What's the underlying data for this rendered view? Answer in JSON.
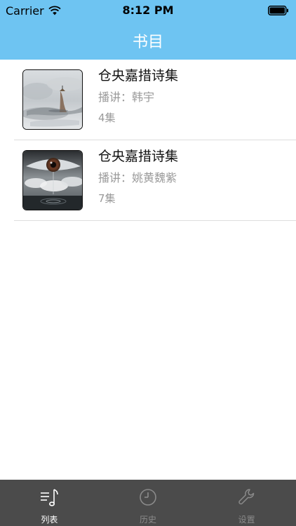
{
  "status_bar": {
    "carrier": "Carrier",
    "time": "8:12 PM",
    "wifi_icon": "wifi-icon",
    "battery_icon": "battery-icon"
  },
  "nav": {
    "title": "书目"
  },
  "books": [
    {
      "title": "仓央嘉措诗集",
      "narrator": "播讲：韩宇",
      "count": "4集",
      "cover": "figure-in-mist-cover"
    },
    {
      "title": "仓央嘉措诗集",
      "narrator": "播讲：姚黄魏紫",
      "count": "7集",
      "cover": "eye-in-clouds-cover"
    }
  ],
  "tabs": [
    {
      "label": "列表",
      "icon": "music-list-icon",
      "active": true
    },
    {
      "label": "历史",
      "icon": "clock-icon",
      "active": false
    },
    {
      "label": "设置",
      "icon": "wrench-icon",
      "active": false
    }
  ],
  "colors": {
    "header_bg": "#6ec4f2",
    "tab_bar_bg": "#4b4b4b",
    "tab_active": "#ffffff",
    "tab_inactive": "#8a8a8a",
    "secondary_text": "#9a9a9a"
  }
}
